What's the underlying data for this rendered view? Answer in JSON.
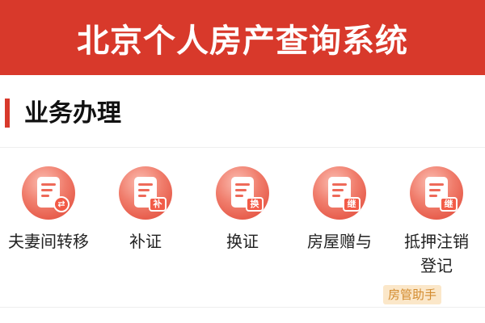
{
  "header": {
    "title": "北京个人房产查询系统"
  },
  "section": {
    "title": "业务办理"
  },
  "services": [
    {
      "label": "夫妻间转移",
      "icon": "doc-swap-icon",
      "badge": "⇄"
    },
    {
      "label": "补证",
      "icon": "doc-supplement-icon",
      "badge": "补"
    },
    {
      "label": "换证",
      "icon": "doc-replace-icon",
      "badge": "换"
    },
    {
      "label": "房屋赠与",
      "icon": "doc-gift-icon",
      "badge": "继"
    },
    {
      "label": "抵押注销登记",
      "icon": "doc-mortgage-icon",
      "badge": "继"
    }
  ],
  "watermark": {
    "text": "房管助手"
  },
  "colors": {
    "brand": "#d8392b",
    "icon_accent": "#f25b47"
  }
}
